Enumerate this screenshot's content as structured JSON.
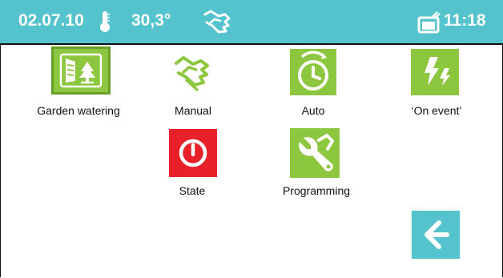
{
  "status": {
    "date": "02.07.10",
    "temperature": "30,3°",
    "time": "11:18",
    "icons": [
      "thermometer-icon",
      "hand-icon",
      "message-icon"
    ]
  },
  "colors": {
    "header": "#55c3ce",
    "green": "#8dc63f",
    "red": "#e8202a",
    "back": "#55c3ce"
  },
  "tiles": [
    {
      "label": "Garden watering",
      "icon": "garden-watering-icon",
      "selected": true
    },
    {
      "label": "Manual",
      "icon": "hand-icon"
    },
    {
      "label": "Auto",
      "icon": "alarm-clock-icon"
    },
    {
      "label": "‘On event’",
      "icon": "lightning-icon"
    },
    {
      "label": "State",
      "icon": "power-icon"
    },
    {
      "label": "Programming",
      "icon": "wrench-icon"
    }
  ],
  "back_button": {
    "icon": "back-arrow-icon"
  }
}
